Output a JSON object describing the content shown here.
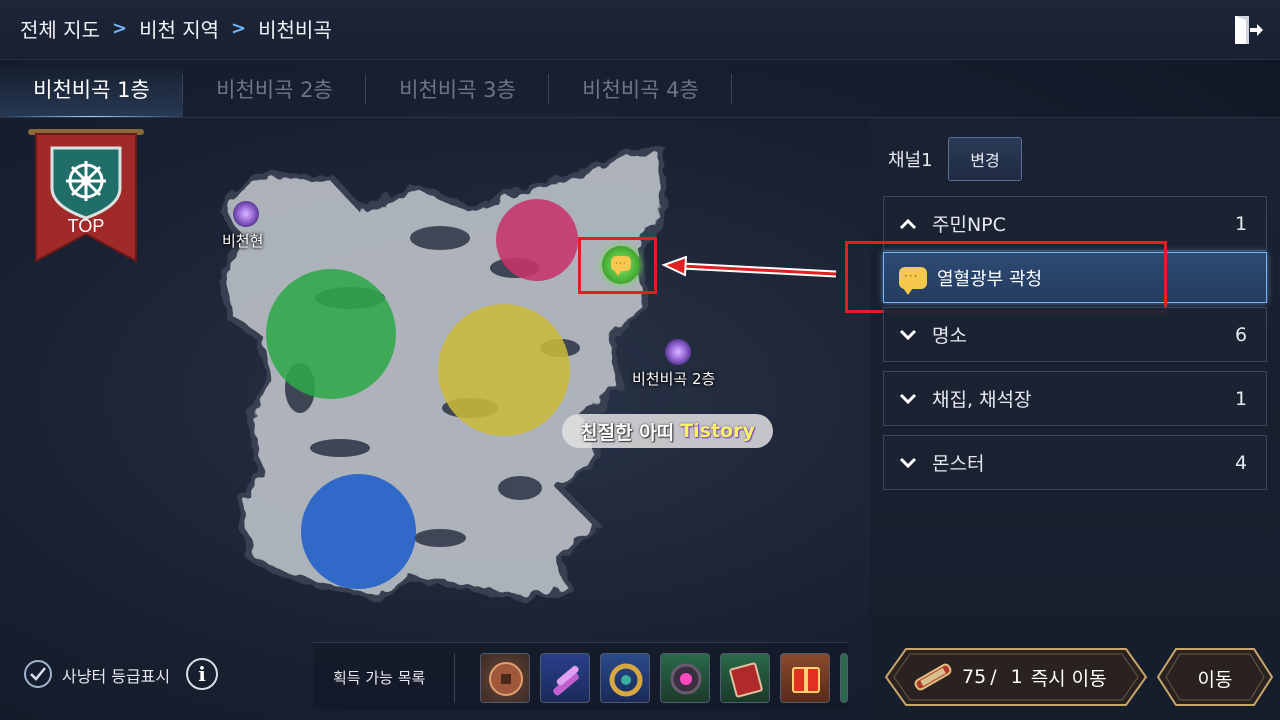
{
  "breadcrumb": {
    "items": [
      "전체 지도",
      "비천 지역",
      "비천비곡"
    ]
  },
  "tabs": [
    {
      "label": "비천비곡 1층",
      "active": true
    },
    {
      "label": "비천비곡 2층",
      "active": false
    },
    {
      "label": "비천비곡 3층",
      "active": false
    },
    {
      "label": "비천비곡 4층",
      "active": false
    }
  ],
  "map": {
    "top_banner_label": "TOP",
    "portals": [
      {
        "label": "비천현"
      },
      {
        "label": "비천비곡 2층"
      }
    ],
    "zone_colors": [
      "#c8336a",
      "#2fa84a",
      "#c9b83a",
      "#1f5fc8"
    ],
    "npc_marker_icon": "chat-bubble-icon",
    "watermark": {
      "part1": "친절한 아띠",
      "part2": "Tistory"
    }
  },
  "channel": {
    "label": "채널1",
    "change_label": "변경"
  },
  "categories": [
    {
      "label": "주민NPC",
      "count": "1",
      "expanded": true
    },
    {
      "label": "명소",
      "count": "6",
      "expanded": false
    },
    {
      "label": "채집, 채석장",
      "count": "1",
      "expanded": false
    },
    {
      "label": "몬스터",
      "count": "4",
      "expanded": false
    }
  ],
  "npc_entries": [
    {
      "label": "열혈광부 곽청",
      "icon": "chat-bubble-icon"
    }
  ],
  "bottom": {
    "hunt_grade_label": "사냥터 등급표시",
    "hunt_grade_checked": true,
    "drops_label": "획득 가능 목록",
    "drop_items": [
      "coin-icon",
      "scroll-bundle-icon",
      "dragon-ring-icon",
      "gem-icon",
      "book-icon",
      "red-box-icon"
    ]
  },
  "actions": {
    "scroll_count": "75",
    "scroll_sep": "/",
    "scroll_cost": "1",
    "instant_move_label": "즉시 이동",
    "move_label": "이동"
  },
  "colors": {
    "accent_blue": "#7ab4ff",
    "highlight_red": "#e02020",
    "gold_frame": "#c8a56a"
  }
}
